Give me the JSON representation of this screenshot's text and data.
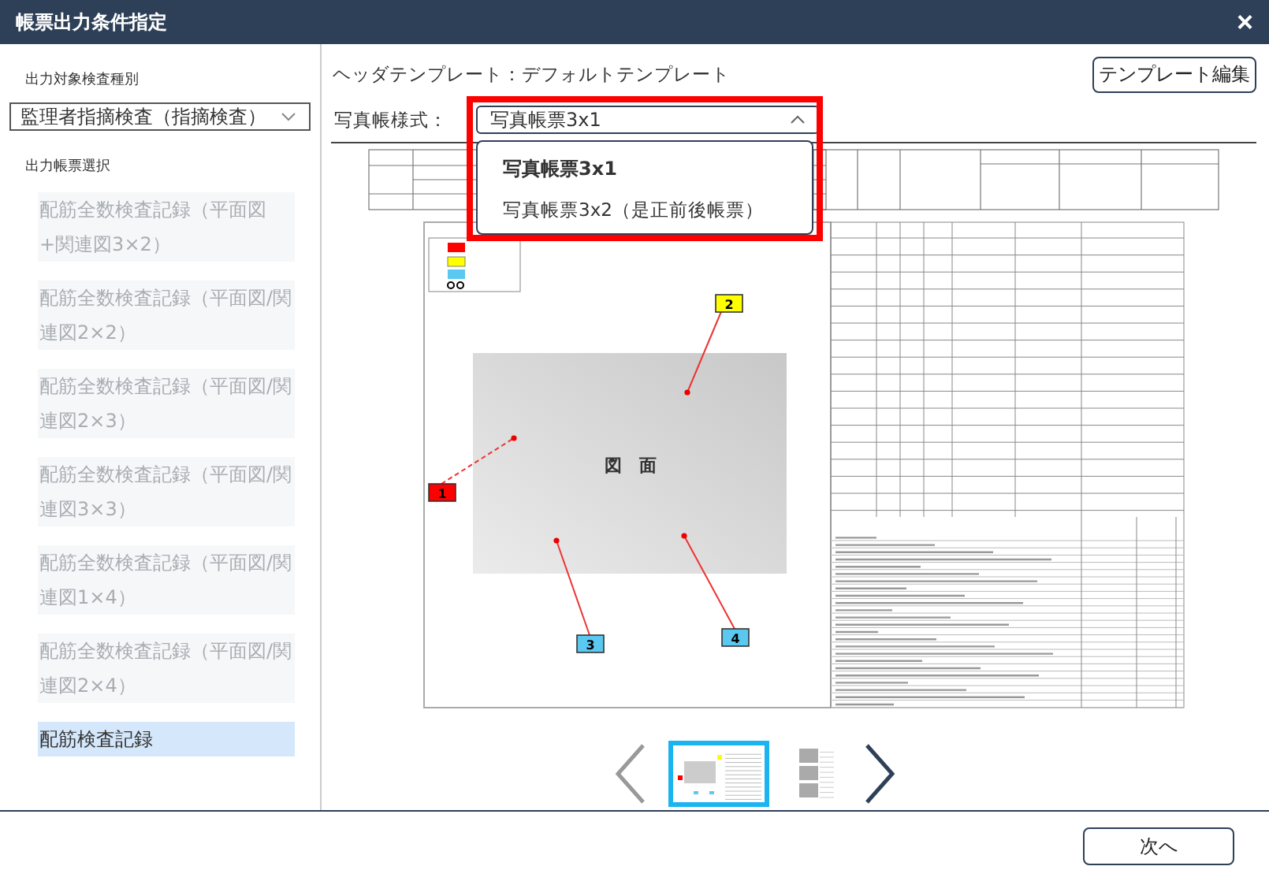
{
  "window": {
    "title": "帳票出力条件指定",
    "close": "×"
  },
  "sidebar": {
    "inspection_type_label": "出力対象検査種別",
    "inspection_type": "監理者指摘検査（指摘検査）",
    "report_label": "出力帳票選択",
    "reports": [
      {
        "label": "配筋全数検査記録（平面図+関連図3×2）",
        "disabled": true,
        "selected": false
      },
      {
        "label": "配筋全数検査記録（平面図/関連図2×2）",
        "disabled": true,
        "selected": false
      },
      {
        "label": "配筋全数検査記録（平面図/関連図2×3）",
        "disabled": true,
        "selected": false
      },
      {
        "label": "配筋全数検査記録（平面図/関連図3×3）",
        "disabled": true,
        "selected": false
      },
      {
        "label": "配筋全数検査記録（平面図/関連図1×4）",
        "disabled": true,
        "selected": false
      },
      {
        "label": "配筋全数検査記録（平面図/関連図2×4）",
        "disabled": true,
        "selected": false
      },
      {
        "label": "配筋検査記録",
        "disabled": false,
        "selected": true
      }
    ]
  },
  "header_template": "ヘッダテンプレート：デフォルトテンプレート",
  "edit_template_button": "テンプレート編集",
  "photo_style": {
    "label": "写真帳様式：",
    "value": "写真帳票3x1",
    "expanded": true,
    "highlighted": true,
    "options": [
      {
        "label": "写真帳票3x1",
        "selected": true
      },
      {
        "label": "写真帳票3x2（是正前後帳票）",
        "selected": false
      }
    ]
  },
  "preview": {
    "plan_label": "図　面",
    "markers": [
      {
        "number": "1",
        "color": "#ff0000"
      },
      {
        "number": "2",
        "color": "#ffff00"
      },
      {
        "number": "3",
        "color": "#5bc8f0"
      },
      {
        "number": "4",
        "color": "#5bc8f0"
      }
    ]
  },
  "pager": {
    "prev_disabled": true,
    "next_disabled": false,
    "thumbnails": [
      {
        "selected": true
      },
      {
        "selected": false
      }
    ]
  },
  "next_button": "次へ"
}
